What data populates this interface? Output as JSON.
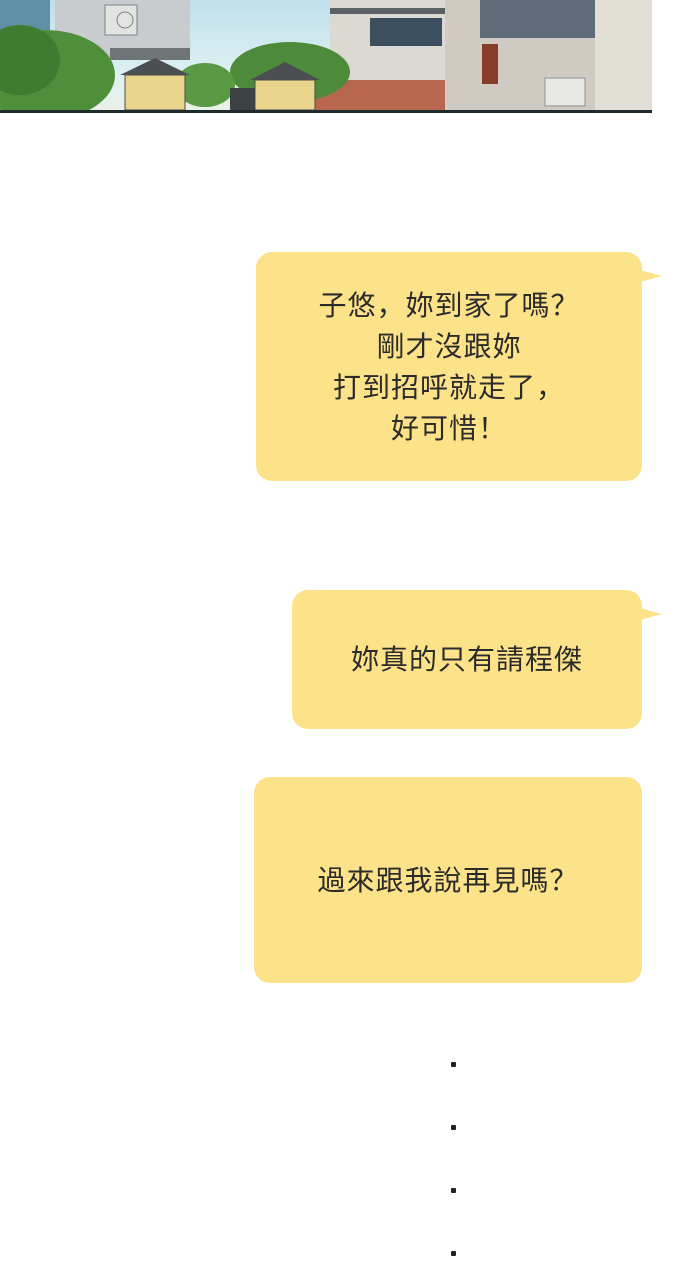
{
  "messages": [
    {
      "lines": [
        "子悠，妳到家了嗎？",
        "剛才沒跟妳",
        "打到招呼就走了，",
        "好可惜！"
      ]
    },
    {
      "lines": [
        "妳真的只有請程傑"
      ]
    },
    {
      "lines": [
        "過來跟我說再見嗎？"
      ]
    }
  ],
  "ellipsis_dots": 4,
  "colors": {
    "bubble": "#fce38a",
    "text": "#2b2b2b",
    "background": "#ffffff"
  }
}
